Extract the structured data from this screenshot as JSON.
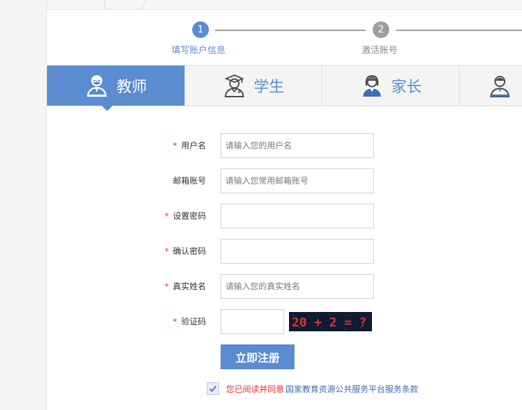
{
  "steps": [
    {
      "number": "1",
      "label": "填写账户信息",
      "state": "active"
    },
    {
      "number": "2",
      "label": "激活账号",
      "state": "inactive"
    }
  ],
  "tabs": [
    {
      "label": "教师",
      "icon": "teacher-icon",
      "active": true
    },
    {
      "label": "学生",
      "icon": "student-icon",
      "active": false
    },
    {
      "label": "家长",
      "icon": "parent-icon",
      "active": false
    },
    {
      "label": "",
      "icon": "user-icon",
      "active": false
    }
  ],
  "form": {
    "required_mark": "*",
    "username": {
      "label": "用户名",
      "placeholder": "请输入您的用户名"
    },
    "email": {
      "label": "邮箱账号",
      "placeholder": "请输入您常用邮箱账号"
    },
    "password": {
      "label": "设置密码",
      "placeholder": ""
    },
    "confirm_password": {
      "label": "确认密码",
      "placeholder": ""
    },
    "real_name": {
      "label": "真实姓名",
      "placeholder": "请输入您的真实姓名"
    },
    "captcha": {
      "label": "验证码",
      "placeholder": "",
      "image_text": "20 + 2 = ?"
    },
    "submit_label": "立即注册",
    "agree_prefix": "您已阅读并同意",
    "agree_link": "国家教育资源公共服务平台服务条款"
  },
  "colors": {
    "primary": "#5b8bd0",
    "required": "#e33333",
    "agree_prefix": "#e33333",
    "link": "#3d6bb5",
    "step_inactive": "#9e9e9e"
  }
}
